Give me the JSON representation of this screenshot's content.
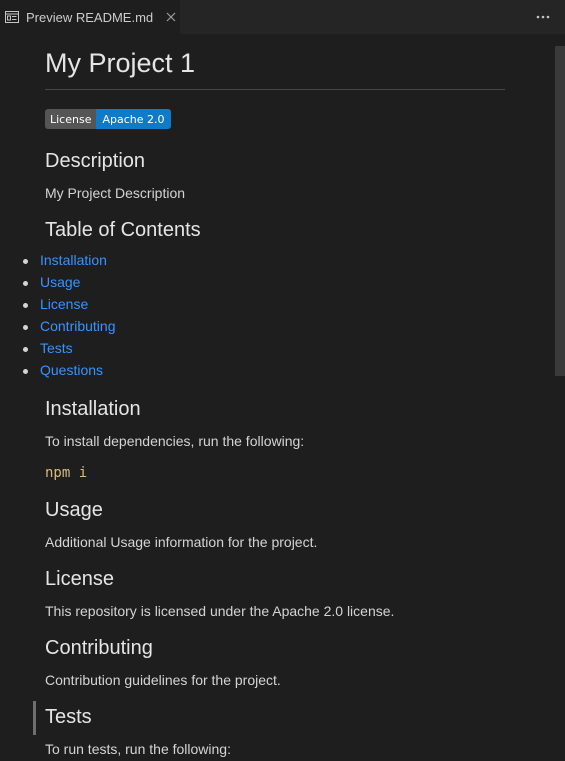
{
  "tab": {
    "icon": "preview-icon",
    "label": "Preview README.md",
    "close_icon": "close-icon"
  },
  "more_actions_icon": "ellipsis-icon",
  "readme": {
    "title": "My Project 1",
    "badge": {
      "left": "License",
      "right": "Apache 2.0",
      "color": "#0f7ac6"
    },
    "description": {
      "heading": "Description",
      "text": "My Project Description"
    },
    "toc": {
      "heading": "Table of Contents",
      "items": [
        "Installation",
        "Usage",
        "License",
        "Contributing",
        "Tests",
        "Questions"
      ]
    },
    "installation": {
      "heading": "Installation",
      "text": "To install dependencies, run the following:",
      "code": "npm i"
    },
    "usage": {
      "heading": "Usage",
      "text": "Additional Usage information for the project."
    },
    "license": {
      "heading": "License",
      "text": "This repository is licensed under the Apache 2.0 license."
    },
    "contributing": {
      "heading": "Contributing",
      "text": "Contribution guidelines for the project."
    },
    "tests": {
      "heading": "Tests",
      "text": "To run tests, run the following:"
    }
  },
  "colors": {
    "background": "#1e1e1e",
    "link": "#3794ff",
    "code": "#d7ba7d"
  }
}
